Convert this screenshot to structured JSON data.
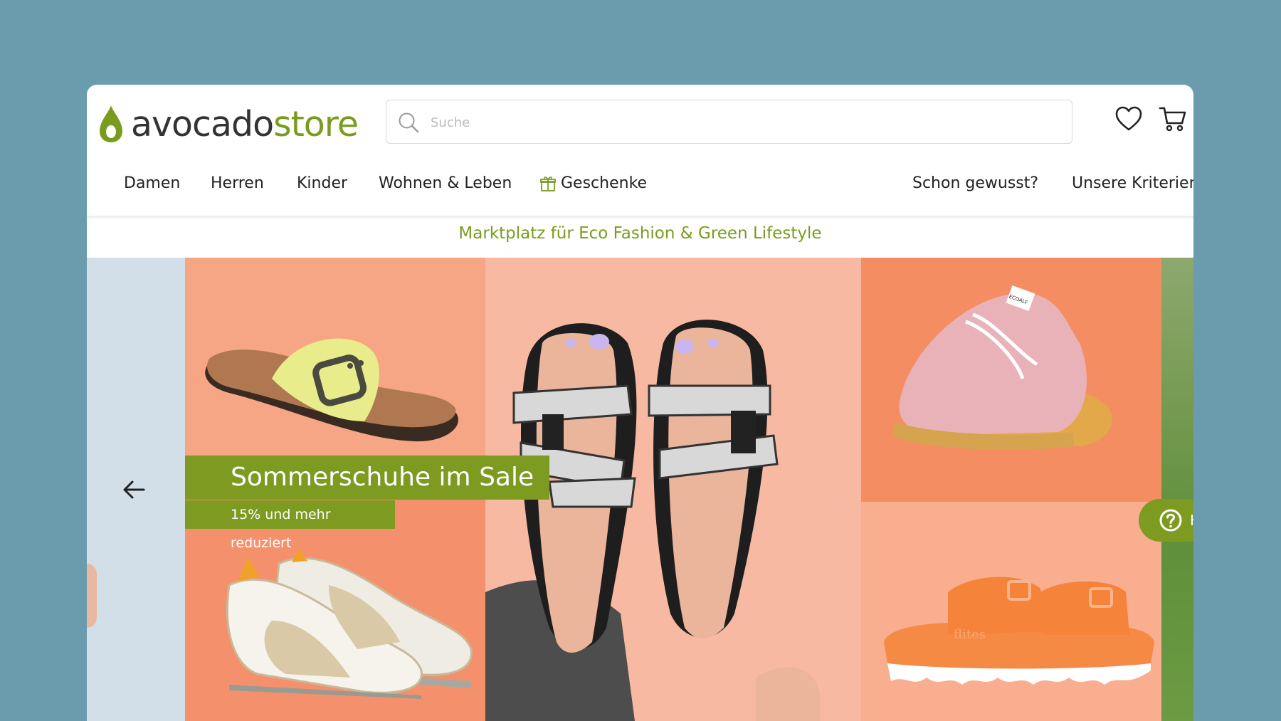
{
  "brand": {
    "part1": "avocado",
    "part2": "store",
    "primary_color": "#7a9c1e"
  },
  "search": {
    "placeholder": "Suche",
    "icon": "search-icon"
  },
  "header_icons": [
    "heart-icon",
    "cart-icon"
  ],
  "nav": {
    "left": [
      "Damen",
      "Herren",
      "Kinder",
      "Wohnen & Leben",
      "Geschenke"
    ],
    "right": [
      "Schon gewusst?",
      "Unsere Kriterien"
    ]
  },
  "tagline": "Marktplatz für Eco Fashion & Green Lifestyle",
  "banner": {
    "title": "Sommerschuhe im Sale",
    "subtitle": "15% und mehr reduziert",
    "product_texts": [
      "ECOALF",
      "flites"
    ]
  },
  "help": {
    "label": "H"
  }
}
